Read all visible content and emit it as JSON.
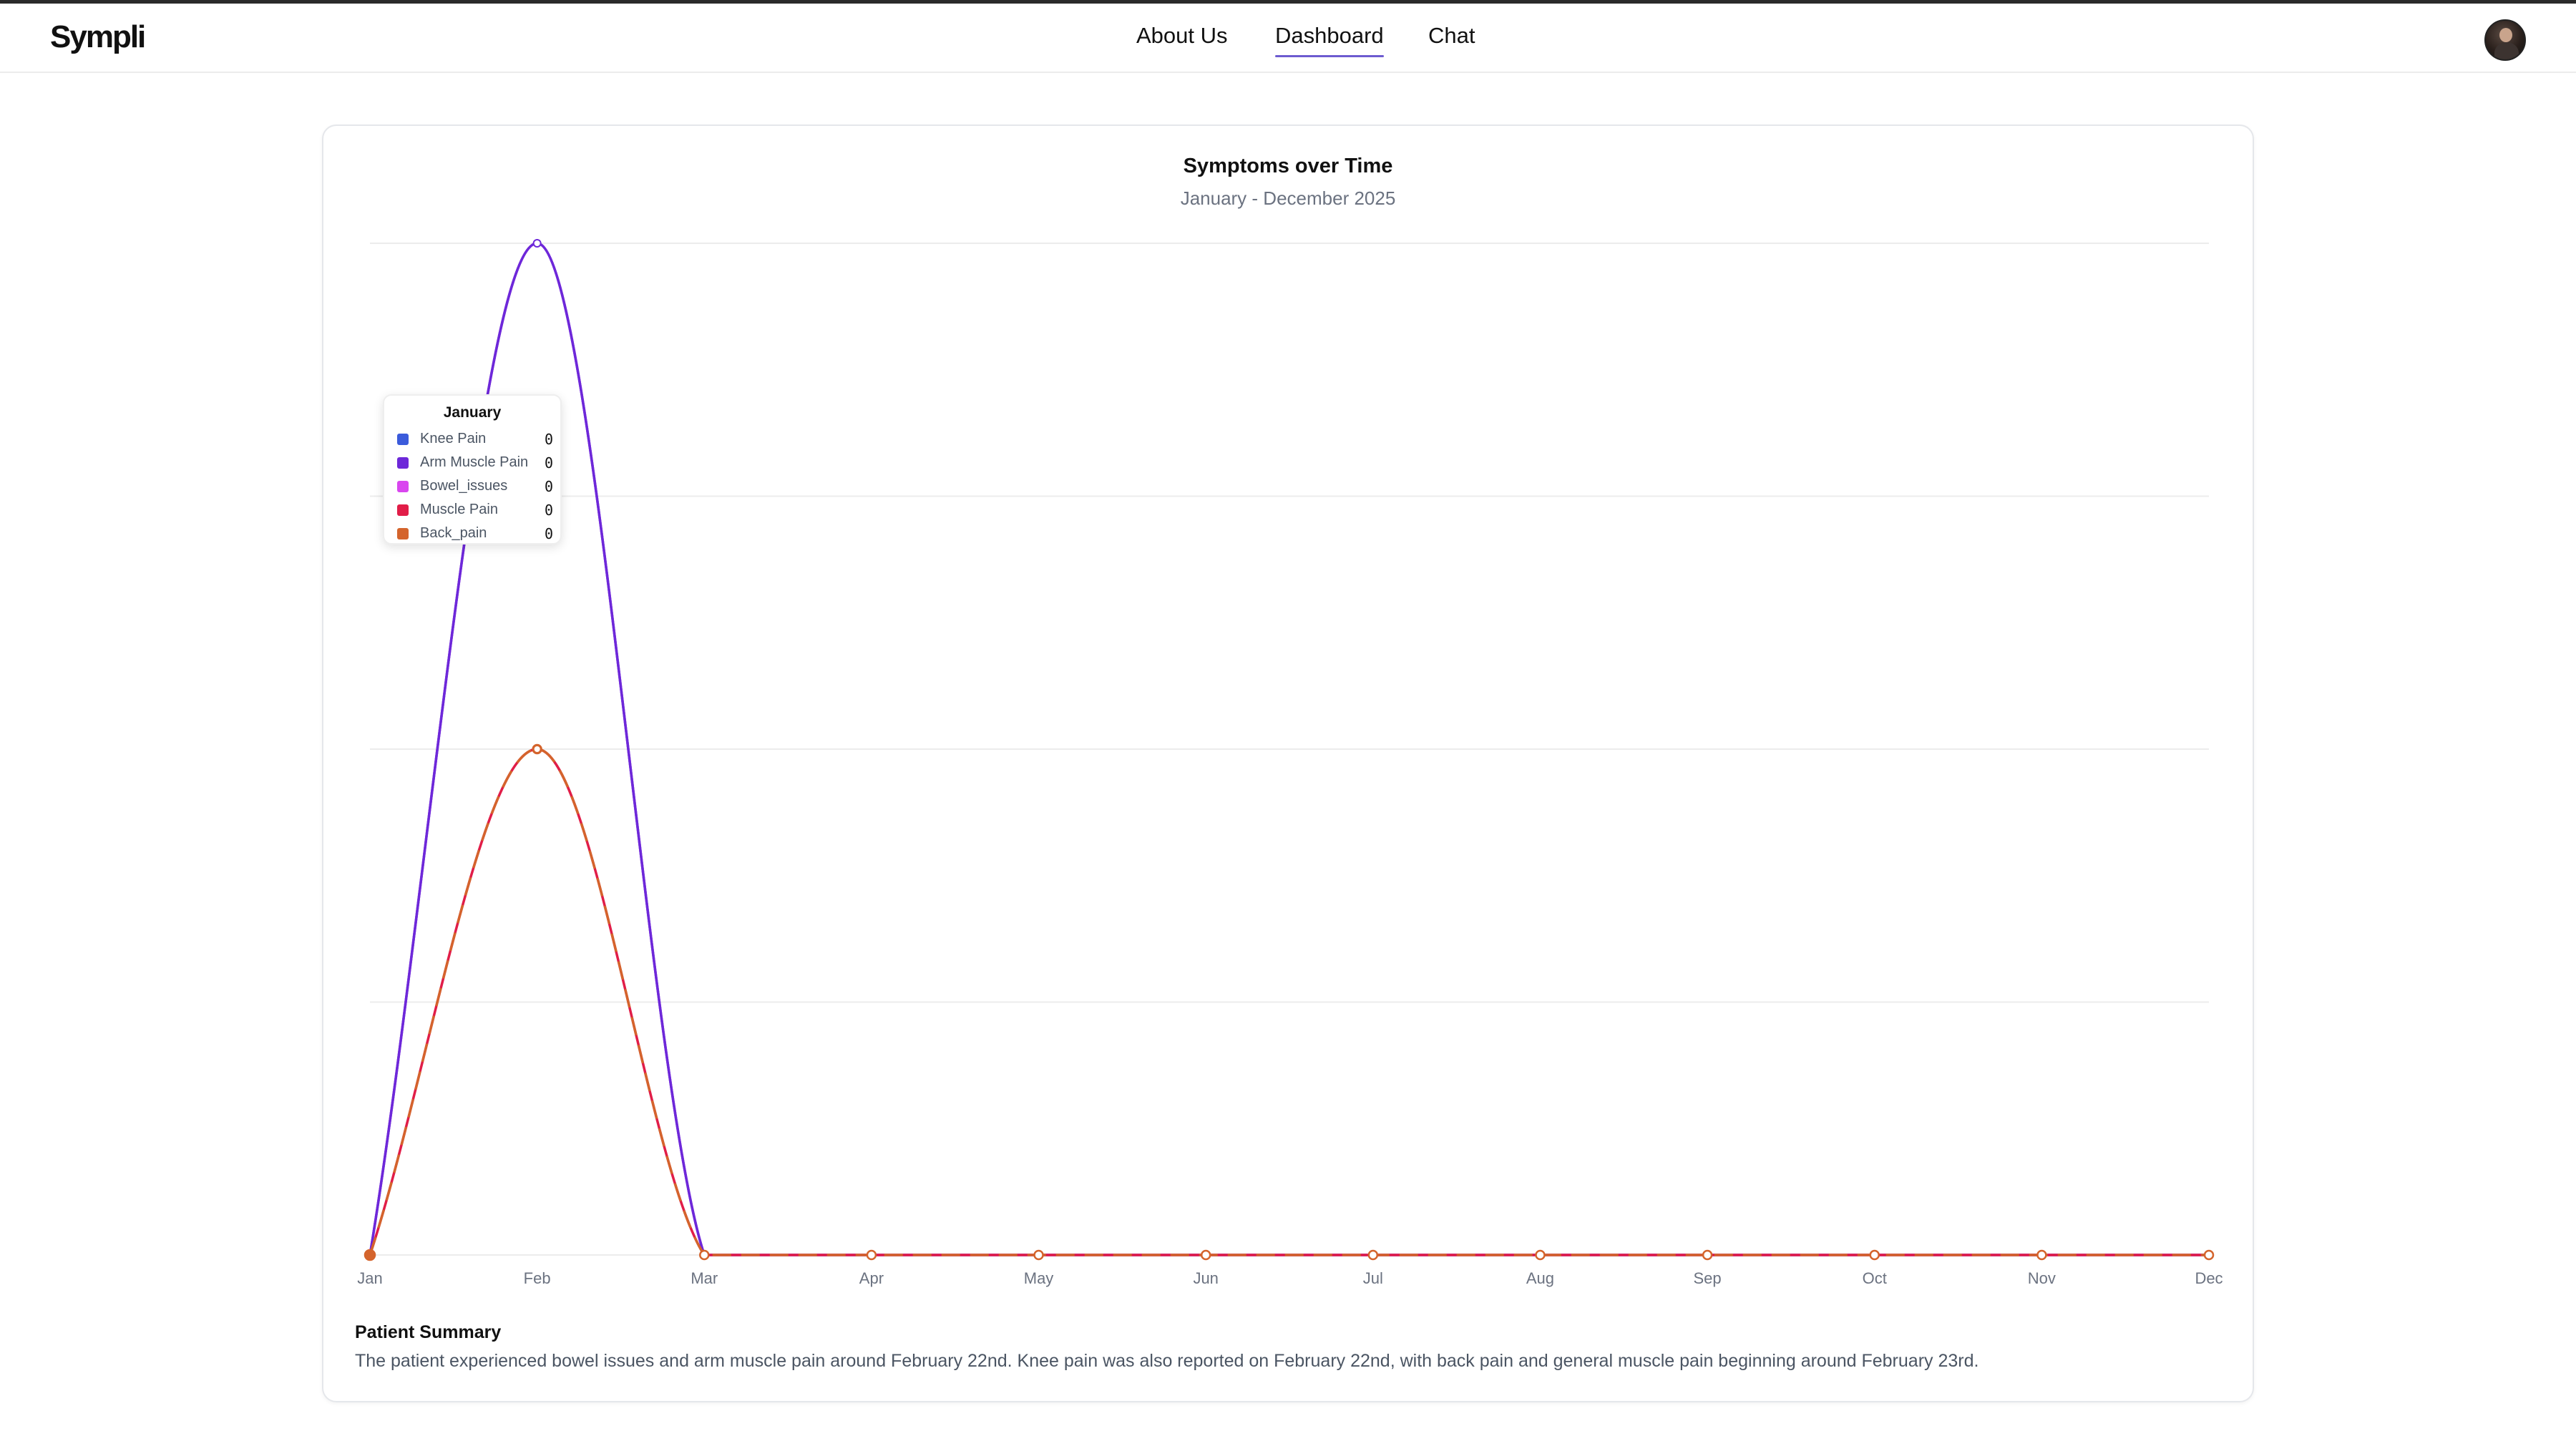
{
  "app": {
    "logo": "Sympli"
  },
  "nav": {
    "items": [
      {
        "label": "About Us",
        "active": false
      },
      {
        "label": "Dashboard",
        "active": true
      },
      {
        "label": "Chat",
        "active": false
      }
    ]
  },
  "colors": {
    "knee_pain": "#3b5bdb",
    "arm_muscle_pain": "#6d28d9",
    "bowel_issues": "#d946ef",
    "muscle_pain": "#e11d48",
    "back_pain": "#d4642c",
    "grid": "#ececec",
    "accent": "#6d5bd0"
  },
  "chart_data": {
    "type": "line",
    "title": "Symptoms over Time",
    "subtitle": "January - December 2025",
    "xlabel": "",
    "ylabel": "",
    "grid": true,
    "x": [
      "Jan",
      "Feb",
      "Mar",
      "Apr",
      "May",
      "Jun",
      "Jul",
      "Aug",
      "Sep",
      "Oct",
      "Nov",
      "Dec"
    ],
    "ylim": [
      0,
      4
    ],
    "series": [
      {
        "name": "Knee Pain",
        "values": [
          0,
          4,
          0,
          0,
          0,
          0,
          0,
          0,
          0,
          0,
          0,
          0
        ]
      },
      {
        "name": "Arm Muscle Pain",
        "values": [
          0,
          4,
          0,
          0,
          0,
          0,
          0,
          0,
          0,
          0,
          0,
          0
        ]
      },
      {
        "name": "Bowel_issues",
        "values": [
          0,
          4,
          0,
          0,
          0,
          0,
          0,
          0,
          0,
          0,
          0,
          0
        ]
      },
      {
        "name": "Muscle Pain",
        "values": [
          0,
          2,
          0,
          0,
          0,
          0,
          0,
          0,
          0,
          0,
          0,
          0
        ]
      },
      {
        "name": "Back_pain",
        "values": [
          0,
          2,
          0,
          0,
          0,
          0,
          0,
          0,
          0,
          0,
          0,
          0
        ]
      }
    ]
  },
  "tooltip": {
    "title": "January",
    "rows": [
      {
        "name": "Knee Pain",
        "value": "0"
      },
      {
        "name": "Arm Muscle Pain",
        "value": "0"
      },
      {
        "name": "Bowel_issues",
        "value": "0"
      },
      {
        "name": "Muscle Pain",
        "value": "0"
      },
      {
        "name": "Back_pain",
        "value": "0"
      }
    ]
  },
  "summary": {
    "title": "Patient Summary",
    "text": "The patient experienced bowel issues and arm muscle pain around February 22nd. Knee pain was also reported on February 22nd, with back pain and general muscle pain beginning around February 23rd."
  }
}
